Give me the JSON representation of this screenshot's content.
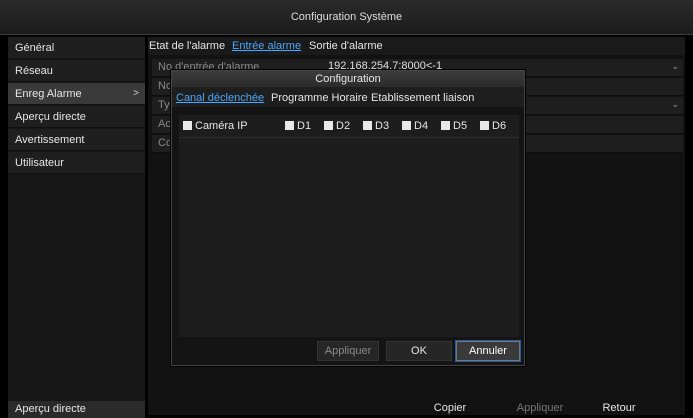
{
  "window": {
    "title": "Configuration Système"
  },
  "sidebar": {
    "items": [
      {
        "label": "Général"
      },
      {
        "label": "Réseau"
      },
      {
        "label": "Enreg Alarme"
      },
      {
        "label": "Aperçu directe"
      },
      {
        "label": "Avertissement"
      },
      {
        "label": "Utilisateur"
      }
    ],
    "chevron": ">",
    "bottom": "Aperçu directe"
  },
  "main": {
    "tabs": [
      {
        "label": "Etat de l'alarme"
      },
      {
        "label": "Entrée alarme"
      },
      {
        "label": "Sortie d'alarme"
      }
    ],
    "rows": [
      {
        "label": "No d'entrée d'alarme",
        "value": "192.168.254.7:8000<-1"
      },
      {
        "label": "Nom",
        "value": ""
      },
      {
        "label": "Typ",
        "value": ""
      },
      {
        "label": "Acti",
        "value": ""
      },
      {
        "label": "Con",
        "value": ""
      }
    ],
    "buttons": {
      "copy": "Copier",
      "apply": "Appliquer",
      "back": "Retour"
    }
  },
  "dialog": {
    "title": "Configuration",
    "tabs": [
      {
        "label": "Canal déclenchée"
      },
      {
        "label": "Programme Horaire"
      },
      {
        "label": "Etablissement liaison"
      }
    ],
    "checkboxes": [
      {
        "label": "Caméra IP"
      },
      {
        "label": "D1"
      },
      {
        "label": "D2"
      },
      {
        "label": "D3"
      },
      {
        "label": "D4"
      },
      {
        "label": "D5"
      },
      {
        "label": "D6"
      }
    ],
    "buttons": {
      "apply": "Appliquer",
      "ok": "OK",
      "cancel": "Annuler"
    }
  },
  "colors": {
    "accent": "#4aa8ff",
    "background": "#000000",
    "panel": "#1e1e1e"
  }
}
